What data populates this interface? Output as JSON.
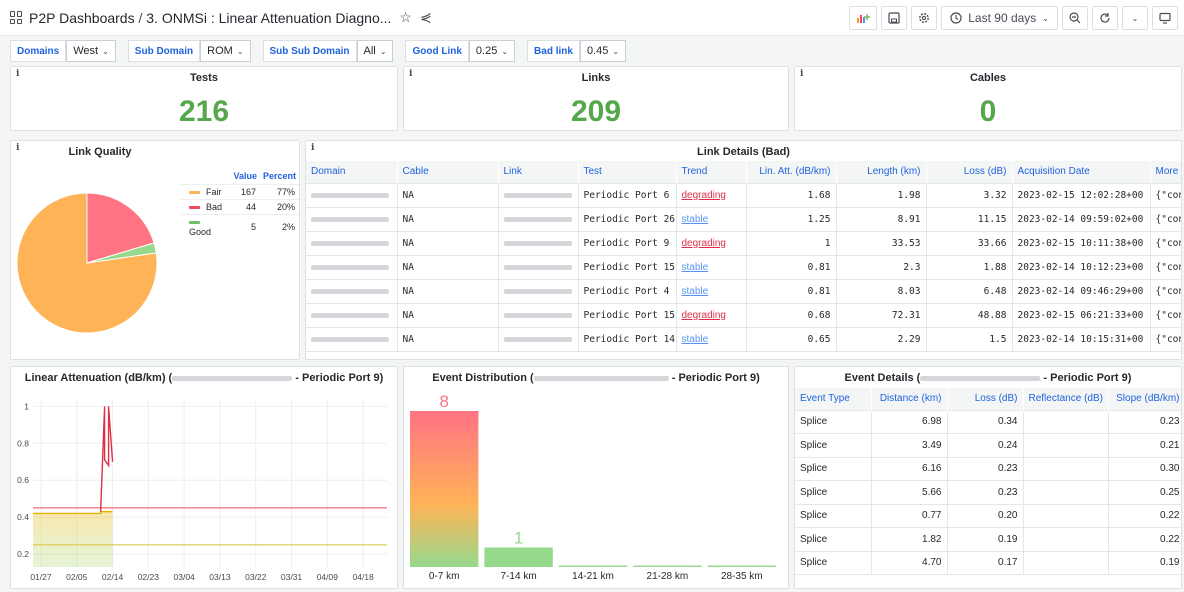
{
  "header": {
    "home": "P2P Dashboards",
    "separator": " / ",
    "dashboard": "3. ONMSi : Linear Attenuation Diagno...",
    "time_range": "Last 90 days"
  },
  "variables": [
    {
      "label": "Domains",
      "value": "West"
    },
    {
      "label": "Sub Domain",
      "value": "ROM"
    },
    {
      "label": "Sub Sub Domain",
      "value": "All"
    },
    {
      "label": "Good Link",
      "value": "0.25"
    },
    {
      "label": "Bad link",
      "value": "0.45"
    }
  ],
  "stats": {
    "tests": {
      "title": "Tests",
      "value": "216"
    },
    "links": {
      "title": "Links",
      "value": "209"
    },
    "cables": {
      "title": "Cables",
      "value": "0"
    }
  },
  "link_quality": {
    "title": "Link Quality",
    "columns": [
      "Value",
      "Percent"
    ],
    "rows": [
      {
        "name": "Fair",
        "value": "167",
        "percent": "77%",
        "color": "#ffb357"
      },
      {
        "name": "Bad",
        "value": "44",
        "percent": "20%",
        "color": "#f2495c"
      },
      {
        "name": "Good",
        "value": "5",
        "percent": "2%",
        "color": "#73bf69"
      }
    ]
  },
  "link_details": {
    "title": "Link Details (Bad)",
    "columns": [
      "Domain",
      "Cable",
      "Link",
      "Test",
      "Trend",
      "Lin. Att. (dB/km)",
      "Length (km)",
      "Loss (dB)",
      "Acquisition Date",
      "More"
    ],
    "rows": [
      {
        "cable": "NA",
        "test": "Periodic Port 6",
        "trend": "degrading",
        "att": "1.68",
        "length": "1.98",
        "loss": "3.32",
        "date": "2023-02-15 12:02:28+00",
        "more": "{\"cont"
      },
      {
        "cable": "NA",
        "test": "Periodic Port 26",
        "trend": "stable",
        "att": "1.25",
        "length": "8.91",
        "loss": "11.15",
        "date": "2023-02-14 09:59:02+00",
        "more": "{\"cont"
      },
      {
        "cable": "NA",
        "test": "Periodic Port 9",
        "trend": "degrading",
        "att": "1",
        "length": "33.53",
        "loss": "33.66",
        "date": "2023-02-15 10:11:38+00",
        "more": "{\"cont"
      },
      {
        "cable": "NA",
        "test": "Periodic Port 15",
        "trend": "stable",
        "att": "0.81",
        "length": "2.3",
        "loss": "1.88",
        "date": "2023-02-14 10:12:23+00",
        "more": "{\"cont"
      },
      {
        "cable": "NA",
        "test": "Periodic Port 4",
        "trend": "stable",
        "att": "0.81",
        "length": "8.03",
        "loss": "6.48",
        "date": "2023-02-14 09:46:29+00",
        "more": "{\"cont"
      },
      {
        "cable": "NA",
        "test": "Periodic Port 15",
        "trend": "degrading",
        "att": "0.68",
        "length": "72.31",
        "loss": "48.88",
        "date": "2023-02-15 06:21:33+00",
        "more": "{\"cont"
      },
      {
        "cable": "NA",
        "test": "Periodic Port 14",
        "trend": "stable",
        "att": "0.65",
        "length": "2.29",
        "loss": "1.5",
        "date": "2023-02-14 10:15:31+00",
        "more": "{\"cont"
      }
    ]
  },
  "linear_attenuation": {
    "title_prefix": "Linear Attenuation (dB/km) (",
    "title_suffix": " - Periodic Port 9)"
  },
  "event_distribution": {
    "title_prefix": "Event Distribution (",
    "title_suffix": " - Periodic Port 9)"
  },
  "event_details": {
    "title_prefix": "Event Details (",
    "title_suffix": " - Periodic Port 9)",
    "columns": [
      "Event Type",
      "Distance (km)",
      "Loss (dB)",
      "Reflectance (dB)",
      "Slope (dB/km)"
    ],
    "rows": [
      {
        "type": "Splice",
        "distance": "6.98",
        "loss": "0.34",
        "reflectance": "",
        "slope": "0.23"
      },
      {
        "type": "Splice",
        "distance": "3.49",
        "loss": "0.24",
        "reflectance": "",
        "slope": "0.21"
      },
      {
        "type": "Splice",
        "distance": "6.16",
        "loss": "0.23",
        "reflectance": "",
        "slope": "0.30"
      },
      {
        "type": "Splice",
        "distance": "5.66",
        "loss": "0.23",
        "reflectance": "",
        "slope": "0.25"
      },
      {
        "type": "Splice",
        "distance": "0.77",
        "loss": "0.20",
        "reflectance": "",
        "slope": "0.22"
      },
      {
        "type": "Splice",
        "distance": "1.82",
        "loss": "0.19",
        "reflectance": "",
        "slope": "0.22"
      },
      {
        "type": "Splice",
        "distance": "4.70",
        "loss": "0.17",
        "reflectance": "",
        "slope": "0.19"
      }
    ]
  },
  "chart_data": [
    {
      "type": "line",
      "x_ticks": [
        "01/27",
        "02/05",
        "02/14",
        "02/23",
        "03/04",
        "03/13",
        "03/22",
        "03/31",
        "04/09",
        "04/18"
      ],
      "y_ticks": [
        "0.2",
        "0.4",
        "0.6",
        "0.8",
        "1"
      ],
      "ylim": [
        0.13,
        1.04
      ],
      "x_range": [
        "01/25",
        "04/24"
      ],
      "series": [
        {
          "color": "#e0b400",
          "points": [
            [
              "01/25",
              0.42
            ],
            [
              "02/11",
              0.42
            ],
            [
              "02/11",
              0.43
            ],
            [
              "02/14",
              0.43
            ]
          ]
        },
        {
          "color": "#e02f44",
          "points": [
            [
              "02/11",
              0.43
            ],
            [
              "02/12",
              1.0
            ],
            [
              "02/12",
              0.71
            ],
            [
              "02/13",
              0.68
            ],
            [
              "02/13",
              1.0
            ],
            [
              "02/14",
              0.7
            ]
          ]
        }
      ],
      "thresholds": [
        {
          "value": 0.45,
          "color": "#f2495c"
        },
        {
          "value": 0.25,
          "color": "#d5c23b"
        }
      ]
    },
    {
      "type": "bar",
      "categories": [
        "0-7 km",
        "7-14 km",
        "14-21 km",
        "21-28 km",
        "28-35 km"
      ],
      "values": [
        8,
        1,
        0,
        0,
        0
      ],
      "colors": {
        "high": "#ff7383",
        "mid": "#ffb357",
        "low": "#96d98d"
      }
    },
    {
      "type": "pie",
      "labels": [
        "Fair",
        "Bad",
        "Good"
      ],
      "values": [
        167,
        44,
        5
      ],
      "colors": [
        "#ffb357",
        "#ff7383",
        "#96d98d"
      ]
    }
  ]
}
